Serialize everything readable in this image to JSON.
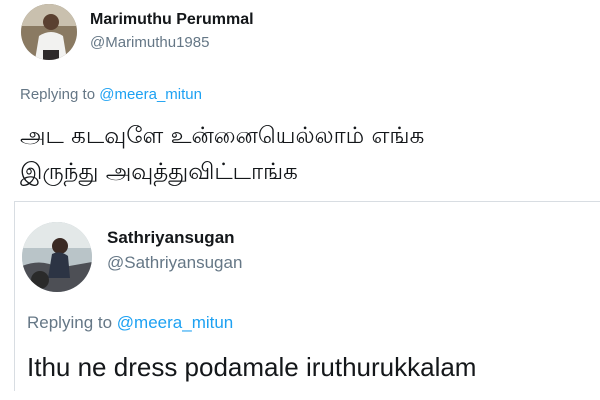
{
  "tweets": [
    {
      "author": {
        "display_name": "Marimuthu Perummal",
        "handle": "@Marimuthu1985",
        "avatar": "profile-photo"
      },
      "replying_to_prefix": "Replying to",
      "replying_to_handle": "@meera_mitun",
      "text_line1": "அட கடவுளே உன்னையெல்லாம் எங்க",
      "text_line2": "இருந்து அவுத்துவிட்டாங்க"
    },
    {
      "author": {
        "display_name": "Sathriyansugan",
        "handle": "@Sathriyansugan",
        "avatar": "profile-photo"
      },
      "replying_to_prefix": "Replying to",
      "replying_to_handle": "@meera_mitun",
      "text_line1": "Ithu ne dress podamale iruthurukkalam"
    }
  ],
  "colors": {
    "name": "#14171a",
    "muted": "#657786",
    "link": "#1da1f2",
    "divider": "#d8dde2"
  }
}
